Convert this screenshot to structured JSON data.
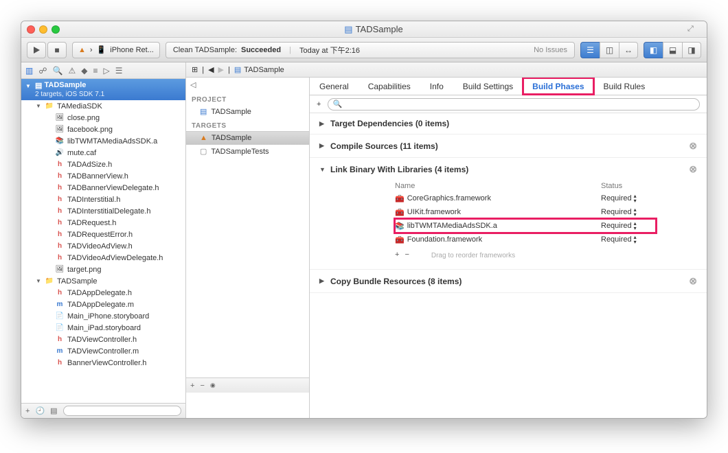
{
  "window": {
    "title": "TADSample"
  },
  "scheme": {
    "target": "iPhone Ret..."
  },
  "status": {
    "action": "Clean TADSample:",
    "result": "Succeeded",
    "time": "Today at 下午2:16",
    "issues": "No Issues"
  },
  "navigator": {
    "projectName": "TADSample",
    "projectSub": "2 targets, iOS SDK 7.1",
    "tree": [
      {
        "type": "folder",
        "name": "TAMediaSDK",
        "indent": 1,
        "open": true
      },
      {
        "type": "file",
        "name": "close.png",
        "indent": 2,
        "icon": "img"
      },
      {
        "type": "file",
        "name": "facebook.png",
        "indent": 2,
        "icon": "img"
      },
      {
        "type": "file",
        "name": "libTWMTAMediaAdsSDK.a",
        "indent": 2,
        "icon": "lib"
      },
      {
        "type": "file",
        "name": "mute.caf",
        "indent": 2,
        "icon": "snd"
      },
      {
        "type": "file",
        "name": "TADAdSize.h",
        "indent": 2,
        "icon": "h"
      },
      {
        "type": "file",
        "name": "TADBannerView.h",
        "indent": 2,
        "icon": "h"
      },
      {
        "type": "file",
        "name": "TADBannerViewDelegate.h",
        "indent": 2,
        "icon": "h"
      },
      {
        "type": "file",
        "name": "TADInterstitial.h",
        "indent": 2,
        "icon": "h"
      },
      {
        "type": "file",
        "name": "TADInterstitialDelegate.h",
        "indent": 2,
        "icon": "h"
      },
      {
        "type": "file",
        "name": "TADRequest.h",
        "indent": 2,
        "icon": "h"
      },
      {
        "type": "file",
        "name": "TADRequestError.h",
        "indent": 2,
        "icon": "h"
      },
      {
        "type": "file",
        "name": "TADVideoAdView.h",
        "indent": 2,
        "icon": "h"
      },
      {
        "type": "file",
        "name": "TADVideoAdViewDelegate.h",
        "indent": 2,
        "icon": "h"
      },
      {
        "type": "file",
        "name": "target.png",
        "indent": 2,
        "icon": "img"
      },
      {
        "type": "folder",
        "name": "TADSample",
        "indent": 1,
        "open": true
      },
      {
        "type": "file",
        "name": "TADAppDelegate.h",
        "indent": 2,
        "icon": "h"
      },
      {
        "type": "file",
        "name": "TADAppDelegate.m",
        "indent": 2,
        "icon": "m"
      },
      {
        "type": "file",
        "name": "Main_iPhone.storyboard",
        "indent": 2,
        "icon": "sb"
      },
      {
        "type": "file",
        "name": "Main_iPad.storyboard",
        "indent": 2,
        "icon": "sb"
      },
      {
        "type": "file",
        "name": "TADViewController.h",
        "indent": 2,
        "icon": "h"
      },
      {
        "type": "file",
        "name": "TADViewController.m",
        "indent": 2,
        "icon": "m"
      },
      {
        "type": "file",
        "name": "BannerViewController.h",
        "indent": 2,
        "icon": "h"
      }
    ]
  },
  "jumpbar": {
    "path": "TADSample"
  },
  "targetsPane": {
    "projectHeader": "PROJECT",
    "projectItems": [
      "TADSample"
    ],
    "targetsHeader": "TARGETS",
    "targetItems": [
      "TADSample",
      "TADSampleTests"
    ]
  },
  "tabs": [
    "General",
    "Capabilities",
    "Info",
    "Build Settings",
    "Build Phases",
    "Build Rules"
  ],
  "activeTab": "Build Phases",
  "phases": {
    "targetDeps": {
      "title": "Target Dependencies (0 items)"
    },
    "compile": {
      "title": "Compile Sources (11 items)"
    },
    "linkBinary": {
      "title": "Link Binary With Libraries (4 items)",
      "colName": "Name",
      "colStatus": "Status",
      "items": [
        {
          "name": "CoreGraphics.framework",
          "status": "Required",
          "icon": "fw",
          "hl": false
        },
        {
          "name": "UIKit.framework",
          "status": "Required",
          "icon": "fw",
          "hl": false
        },
        {
          "name": "libTWMTAMediaAdsSDK.a",
          "status": "Required",
          "icon": "lib",
          "hl": true
        },
        {
          "name": "Foundation.framework",
          "status": "Required",
          "icon": "fw",
          "hl": false
        }
      ],
      "hint": "Drag to reorder frameworks"
    },
    "copyBundle": {
      "title": "Copy Bundle Resources (8 items)"
    }
  }
}
